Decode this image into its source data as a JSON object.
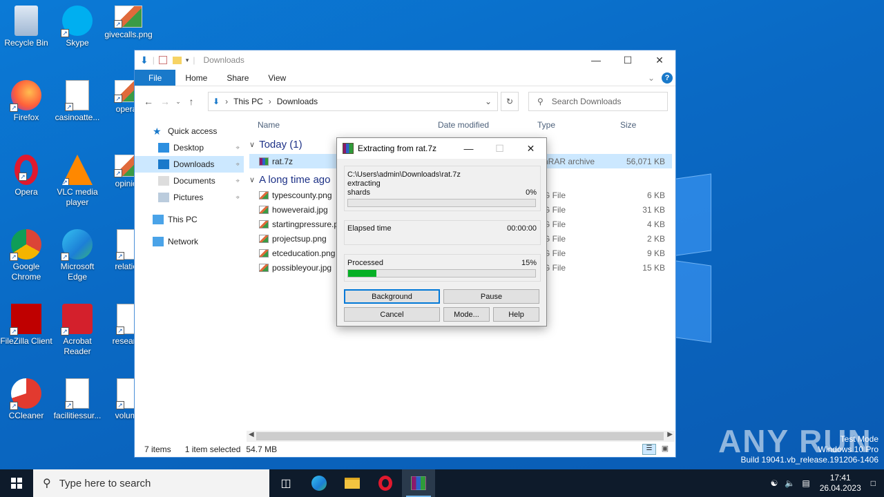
{
  "desktop": {
    "icons": [
      {
        "label": "Recycle Bin",
        "icon": "recycle-bin-icon"
      },
      {
        "label": "Skype",
        "icon": "skype-icon"
      },
      {
        "label": "givecalls.png",
        "icon": "image-file-icon"
      },
      {
        "label": "Firefox",
        "icon": "firefox-icon"
      },
      {
        "label": "casinoatte...",
        "icon": "word-document-icon"
      },
      {
        "label": "operati",
        "icon": "image-file-icon"
      },
      {
        "label": "Opera",
        "icon": "opera-icon"
      },
      {
        "label": "VLC media player",
        "icon": "vlc-icon"
      },
      {
        "label": "opinion",
        "icon": "image-file-icon"
      },
      {
        "label": "Google Chrome",
        "icon": "chrome-icon"
      },
      {
        "label": "Microsoft Edge",
        "icon": "edge-icon"
      },
      {
        "label": "relation",
        "icon": "word-document-icon"
      },
      {
        "label": "FileZilla Client",
        "icon": "filezilla-icon"
      },
      {
        "label": "Acrobat Reader",
        "icon": "acrobat-icon"
      },
      {
        "label": "research",
        "icon": "word-document-icon"
      },
      {
        "label": "CCleaner",
        "icon": "ccleaner-icon"
      },
      {
        "label": "facilitiessur...",
        "icon": "word-document-icon"
      },
      {
        "label": "volume",
        "icon": "word-document-icon"
      }
    ],
    "watermark": {
      "line1": "Test Mode",
      "line2": "Windows 10 Pro",
      "line3": "Build 19041.vb_release.191206-1406"
    },
    "anyrun": "ANY RUN"
  },
  "explorer": {
    "title": "Downloads",
    "ribbon_tabs": [
      "File",
      "Home",
      "Share",
      "View"
    ],
    "breadcrumb": [
      "This PC",
      "Downloads"
    ],
    "search_placeholder": "Search Downloads",
    "nav": [
      {
        "label": "Quick access",
        "icon": "star-icon"
      },
      {
        "label": "Desktop",
        "icon": "desktop-folder-icon",
        "pinned": true
      },
      {
        "label": "Downloads",
        "icon": "downloads-folder-icon",
        "pinned": true,
        "selected": true
      },
      {
        "label": "Documents",
        "icon": "documents-folder-icon",
        "pinned": true
      },
      {
        "label": "Pictures",
        "icon": "pictures-folder-icon",
        "pinned": true
      },
      {
        "label": "This PC",
        "icon": "computer-icon"
      },
      {
        "label": "Network",
        "icon": "network-icon"
      }
    ],
    "columns": {
      "name": "Name",
      "date": "Date modified",
      "type": "Type",
      "size": "Size"
    },
    "groups": [
      {
        "label": "Today (1)",
        "files": [
          {
            "name": "rat.7z",
            "type": "nRAR archive",
            "size": "56,071 KB",
            "selected": true
          }
        ]
      },
      {
        "label": "A long time ago",
        "files": [
          {
            "name": "typescounty.png",
            "type": "G File",
            "size": "6 KB"
          },
          {
            "name": "howeveraid.jpg",
            "type": "G File",
            "size": "31 KB"
          },
          {
            "name": "startingpressure.p",
            "type": "G File",
            "size": "4 KB"
          },
          {
            "name": "projectsup.png",
            "type": "G File",
            "size": "2 KB"
          },
          {
            "name": "etceducation.png",
            "type": "G File",
            "size": "9 KB"
          },
          {
            "name": "possibleyour.jpg",
            "type": "G File",
            "size": "15 KB"
          }
        ]
      }
    ],
    "status": {
      "items": "7 items",
      "selected": "1 item selected",
      "size": "54.7 MB"
    }
  },
  "dialog": {
    "title": "Extracting from rat.7z",
    "path": "C:\\Users\\admin\\Downloads\\rat.7z",
    "action": "extracting",
    "current_file": "shards",
    "file_percent_label": "0%",
    "file_progress": 0,
    "elapsed_label": "Elapsed time",
    "elapsed_value": "00:00:00",
    "processed_label": "Processed",
    "processed_percent_label": "15%",
    "processed_progress": 0.15,
    "buttons": {
      "background": "Background",
      "pause": "Pause",
      "cancel": "Cancel",
      "mode": "Mode...",
      "help": "Help"
    }
  },
  "taskbar": {
    "search_placeholder": "Type here to search",
    "apps": [
      "task-view-icon",
      "edge-icon",
      "file-explorer-icon",
      "opera-icon",
      "winrar-icon"
    ],
    "time": "17:41",
    "date": "26.04.2023"
  }
}
